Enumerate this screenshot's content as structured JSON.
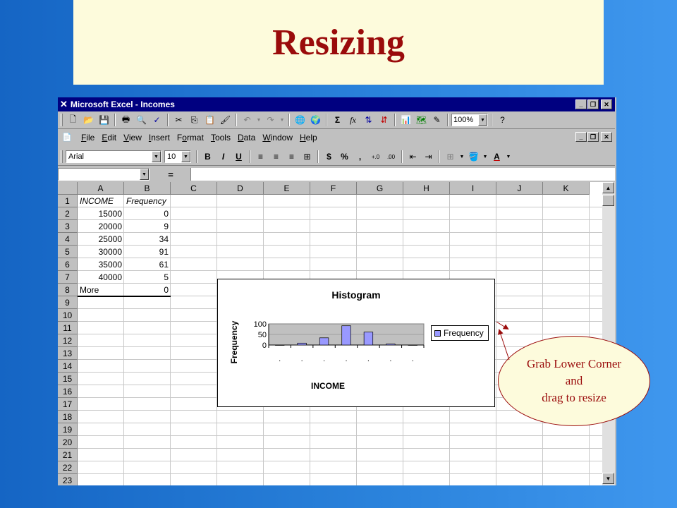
{
  "slide": {
    "title": "Resizing"
  },
  "window": {
    "title": "Microsoft Excel - Incomes"
  },
  "toolbar": {
    "zoom": "100%"
  },
  "menu": [
    {
      "label": "File",
      "key": "F",
      "rest": "ile"
    },
    {
      "label": "Edit",
      "key": "E",
      "rest": "dit"
    },
    {
      "label": "View",
      "key": "V",
      "rest": "iew"
    },
    {
      "label": "Insert",
      "key": "I",
      "rest": "nsert"
    },
    {
      "label": "Format",
      "key": "o",
      "pre": "F",
      "rest": "rmat"
    },
    {
      "label": "Tools",
      "key": "T",
      "rest": "ools"
    },
    {
      "label": "Data",
      "key": "D",
      "rest": "ata"
    },
    {
      "label": "Window",
      "key": "W",
      "rest": "indow"
    },
    {
      "label": "Help",
      "key": "H",
      "rest": "elp"
    }
  ],
  "format": {
    "font": "Arial",
    "size": "10"
  },
  "formula_bar": {
    "eq": "="
  },
  "sheet": {
    "columns": [
      "A",
      "B",
      "C",
      "D",
      "E",
      "F",
      "G",
      "H",
      "I",
      "J",
      "K"
    ],
    "rows": [
      "1",
      "2",
      "3",
      "4",
      "5",
      "6",
      "7",
      "8",
      "9",
      "10",
      "11",
      "12",
      "13",
      "14",
      "15",
      "16",
      "17",
      "18",
      "19",
      "20",
      "21",
      "22",
      "23"
    ],
    "headers": {
      "a": "INCOME",
      "b": "Frequency"
    },
    "data": [
      {
        "a": "15000",
        "b": "0"
      },
      {
        "a": "20000",
        "b": "9"
      },
      {
        "a": "25000",
        "b": "34"
      },
      {
        "a": "30000",
        "b": "91"
      },
      {
        "a": "35000",
        "b": "61"
      },
      {
        "a": "40000",
        "b": "5"
      },
      {
        "a": "More",
        "b": "0"
      }
    ]
  },
  "chart_data": {
    "type": "bar",
    "title": "Histogram",
    "xlabel": "INCOME",
    "ylabel": "Frequency",
    "categories": [
      "15000",
      "20000",
      "25000",
      "30000",
      "35000",
      "40000",
      "More"
    ],
    "series": [
      {
        "name": "Frequency",
        "values": [
          0,
          9,
          34,
          91,
          61,
          5,
          0
        ],
        "color": "#9999ff"
      }
    ],
    "yticks": [
      "100",
      "50",
      "0"
    ],
    "ylim": [
      0,
      100
    ],
    "legend_position": "right"
  },
  "callout": {
    "line1": "Grab Lower Corner",
    "line2": "and",
    "line3": "drag to resize"
  }
}
